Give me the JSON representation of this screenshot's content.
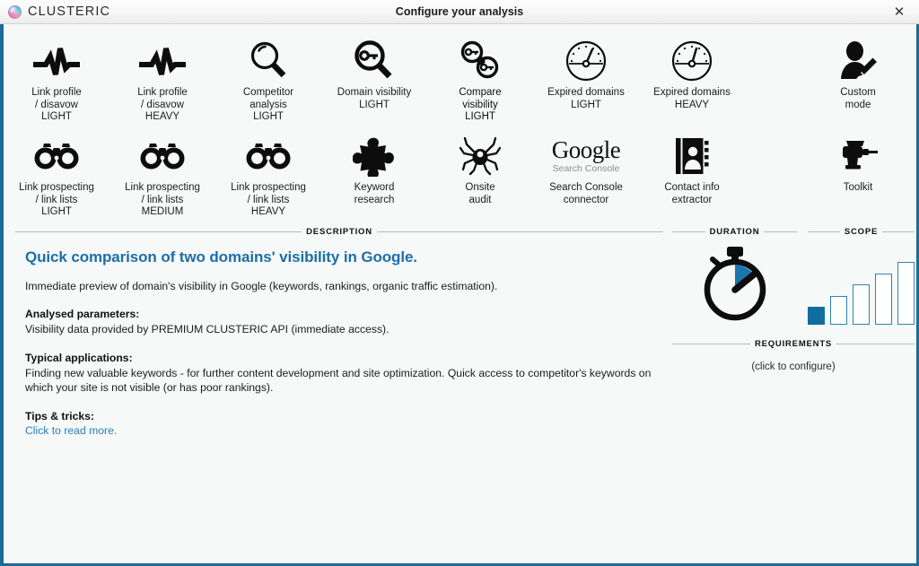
{
  "window": {
    "brand": "CLUSTERIC",
    "title": "Configure your analysis",
    "close_label": "✕",
    "accent_color": "#1b6c97"
  },
  "modes": {
    "row1": [
      {
        "label": "Link profile\n/ disavow\nLIGHT",
        "icon": "pulse-icon",
        "selected": false
      },
      {
        "label": "Link profile\n/ disavow\nHEAVY",
        "icon": "pulse-icon",
        "selected": false
      },
      {
        "label": "Competitor\nanalysis\nLIGHT",
        "icon": "magnifier-icon",
        "selected": false
      },
      {
        "label": "Domain visibility\nLIGHT",
        "icon": "magnifier-key-icon",
        "selected": false
      },
      {
        "label": "Compare\nvisibility\nLIGHT",
        "icon": "compare-magnifier-keys-icon",
        "selected": true
      },
      {
        "label": "Expired domains\nLIGHT",
        "icon": "gauge-icon",
        "selected": false
      },
      {
        "label": "Expired domains\nHEAVY",
        "icon": "gauge-icon",
        "selected": false
      },
      {
        "label": "Custom\nmode",
        "icon": "user-pencil-icon",
        "selected": false
      }
    ],
    "row2": [
      {
        "label": "Link prospecting\n/ link lists\nLIGHT",
        "icon": "binoculars-icon",
        "selected": false
      },
      {
        "label": "Link prospecting\n/ link lists\nMEDIUM",
        "icon": "binoculars-icon",
        "selected": false
      },
      {
        "label": "Link prospecting\n/ link lists\nHEAVY",
        "icon": "binoculars-icon",
        "selected": false
      },
      {
        "label": "Keyword\nresearch",
        "icon": "puzzle-piece-icon",
        "selected": false
      },
      {
        "label": "Onsite\naudit",
        "icon": "spider-icon",
        "selected": false
      },
      {
        "label": "Search Console\nconnector",
        "icon": "google-search-console-icon",
        "selected": false
      },
      {
        "label": "Contact info\nextractor",
        "icon": "address-book-icon",
        "selected": false
      },
      {
        "label": "Toolkit",
        "icon": "drill-icon",
        "selected": false
      }
    ],
    "gsc_logo": {
      "word_google": "Google",
      "word_sub": "Search Console"
    }
  },
  "description": {
    "section_label": "DESCRIPTION",
    "headline": "Quick comparison of two domains' visibility in Google.",
    "intro": "Immediate preview of domain's visibility in Google (keywords, rankings, organic traffic estimation).",
    "analysed_label": "Analysed parameters:",
    "analysed_text": "Visibility data provided by PREMIUM CLUSTERIC API (immediate access).",
    "applications_label": "Typical applications:",
    "applications_text": "Finding new valuable keywords - for further content development and site optimization. Quick access to competitor's keywords on which your site is not visible (or has poor rankings).",
    "tips_label": "Tips & tricks:",
    "tips_link": "Click to read more."
  },
  "duration": {
    "section_label": "DURATION",
    "icon": "stopwatch-icon"
  },
  "scope": {
    "section_label": "SCOPE",
    "icon": "bar-levels-icon",
    "levels": 5,
    "filled": 1
  },
  "requirements": {
    "section_label": "REQUIREMENTS",
    "note": "(click to configure)"
  }
}
